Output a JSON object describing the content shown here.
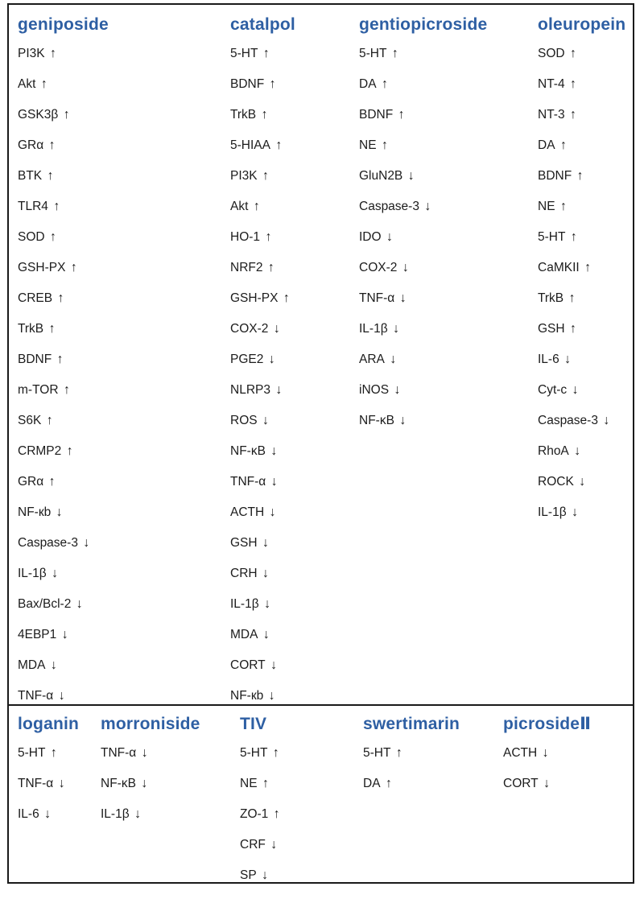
{
  "table": {
    "top_block": {
      "columns": [
        {
          "header": "geniposide",
          "items": [
            {
              "name": "PI3K",
              "arrow": "↑"
            },
            {
              "name": "Akt",
              "arrow": "↑"
            },
            {
              "name": "GSK3β",
              "arrow": "↑"
            },
            {
              "name": "GRα",
              "arrow": "↑"
            },
            {
              "name": "BTK",
              "arrow": "↑"
            },
            {
              "name": "TLR4",
              "arrow": "↑"
            },
            {
              "name": "SOD",
              "arrow": "↑"
            },
            {
              "name": "GSH-PX",
              "arrow": "↑"
            },
            {
              "name": "CREB",
              "arrow": "↑"
            },
            {
              "name": "TrkB",
              "arrow": "↑"
            },
            {
              "name": "BDNF",
              "arrow": "↑"
            },
            {
              "name": "m-TOR",
              "arrow": "↑"
            },
            {
              "name": "S6K",
              "arrow": "↑"
            },
            {
              "name": "CRMP2",
              "arrow": "↑"
            },
            {
              "name": "GRα",
              "arrow": "↑"
            },
            {
              "name": "NF-кb",
              "arrow": "↓"
            },
            {
              "name": "Caspase-3",
              "arrow": "↓"
            },
            {
              "name": "IL-1β",
              "arrow": "↓"
            },
            {
              "name": "Bax/Bcl-2",
              "arrow": "↓"
            },
            {
              "name": "4EBP1",
              "arrow": "↓"
            },
            {
              "name": "MDA",
              "arrow": "↓"
            },
            {
              "name": "TNF-α",
              "arrow": "↓"
            }
          ]
        },
        {
          "header": "catalpol",
          "items": [
            {
              "name": "5-HT",
              "arrow": "↑"
            },
            {
              "name": "BDNF",
              "arrow": "↑"
            },
            {
              "name": "TrkB",
              "arrow": "↑"
            },
            {
              "name": "5-HIAA",
              "arrow": "↑"
            },
            {
              "name": "PI3K",
              "arrow": "↑"
            },
            {
              "name": "Akt",
              "arrow": "↑"
            },
            {
              "name": "HO-1",
              "arrow": "↑"
            },
            {
              "name": "NRF2",
              "arrow": "↑"
            },
            {
              "name": "GSH-PX",
              "arrow": "↑"
            },
            {
              "name": "COX-2",
              "arrow": "↓"
            },
            {
              "name": "PGE2",
              "arrow": "↓"
            },
            {
              "name": "NLRP3",
              "arrow": "↓"
            },
            {
              "name": "ROS",
              "arrow": "↓"
            },
            {
              "name": "NF-κB",
              "arrow": "↓"
            },
            {
              "name": "TNF-α",
              "arrow": "↓"
            },
            {
              "name": "ACTH",
              "arrow": "↓"
            },
            {
              "name": "GSH",
              "arrow": "↓"
            },
            {
              "name": "CRH",
              "arrow": "↓"
            },
            {
              "name": "IL-1β",
              "arrow": "↓"
            },
            {
              "name": "MDA",
              "arrow": "↓"
            },
            {
              "name": "CORT",
              "arrow": "↓"
            },
            {
              "name": "NF-кb",
              "arrow": "↓"
            }
          ]
        },
        {
          "header": "gentiopicroside",
          "items": [
            {
              "name": "5-HT",
              "arrow": "↑"
            },
            {
              "name": "DA",
              "arrow": "↑"
            },
            {
              "name": "BDNF",
              "arrow": "↑"
            },
            {
              "name": "NE",
              "arrow": "↑"
            },
            {
              "name": "GluN2B",
              "arrow": "↓"
            },
            {
              "name": "Caspase-3",
              "arrow": "↓"
            },
            {
              "name": "IDO",
              "arrow": "↓"
            },
            {
              "name": "COX-2",
              "arrow": "↓"
            },
            {
              "name": "TNF-α",
              "arrow": "↓"
            },
            {
              "name": "IL-1β",
              "arrow": "↓"
            },
            {
              "name": "ARA",
              "arrow": "↓"
            },
            {
              "name": "iNOS",
              "arrow": "↓"
            },
            {
              "name": "NF-κB",
              "arrow": "↓"
            }
          ]
        },
        {
          "header": "oleuropein",
          "items": [
            {
              "name": "SOD",
              "arrow": "↑"
            },
            {
              "name": "NT-4",
              "arrow": "↑"
            },
            {
              "name": "NT-3",
              "arrow": "↑"
            },
            {
              "name": "DA",
              "arrow": "↑"
            },
            {
              "name": "BDNF",
              "arrow": "↑"
            },
            {
              "name": "NE",
              "arrow": "↑"
            },
            {
              "name": "5-HT",
              "arrow": "↑"
            },
            {
              "name": "CaMKII",
              "arrow": "↑"
            },
            {
              "name": "TrkB",
              "arrow": "↑"
            },
            {
              "name": "GSH",
              "arrow": "↑"
            },
            {
              "name": "IL-6",
              "arrow": "↓"
            },
            {
              "name": "Cyt-c",
              "arrow": "↓"
            },
            {
              "name": "Caspase-3",
              "arrow": "↓"
            },
            {
              "name": "RhoA",
              "arrow": "↓"
            },
            {
              "name": "ROCK",
              "arrow": "↓"
            },
            {
              "name": "IL-1β",
              "arrow": "↓"
            }
          ]
        }
      ]
    },
    "bottom_block": {
      "columns": [
        {
          "header": "loganin",
          "items": [
            {
              "name": "5-HT",
              "arrow": "↑"
            },
            {
              "name": "TNF-α",
              "arrow": "↓"
            },
            {
              "name": "IL-6",
              "arrow": "↓"
            }
          ]
        },
        {
          "header": "morroniside",
          "items": [
            {
              "name": "TNF-α",
              "arrow": "↓"
            },
            {
              "name": "NF-κB",
              "arrow": "↓"
            },
            {
              "name": "IL-1β",
              "arrow": "↓"
            }
          ]
        },
        {
          "header": "TIV",
          "items": [
            {
              "name": "5-HT",
              "arrow": "↑"
            },
            {
              "name": "NE",
              "arrow": "↑"
            },
            {
              "name": "ZO-1",
              "arrow": "↑"
            },
            {
              "name": "CRF",
              "arrow": "↓"
            },
            {
              "name": "SP",
              "arrow": "↓"
            }
          ]
        },
        {
          "header": "swertimarin",
          "items": [
            {
              "name": "5-HT",
              "arrow": "↑"
            },
            {
              "name": "DA",
              "arrow": "↑"
            }
          ]
        },
        {
          "header": "picrosideⅡ",
          "items": [
            {
              "name": "ACTH",
              "arrow": "↓"
            },
            {
              "name": "CORT",
              "arrow": "↓"
            }
          ]
        }
      ]
    }
  },
  "colors": {
    "header_blue": "#2e5fa3",
    "item_black": "#1c1c1c",
    "border": "#1a1a1a",
    "background": "#ffffff"
  }
}
